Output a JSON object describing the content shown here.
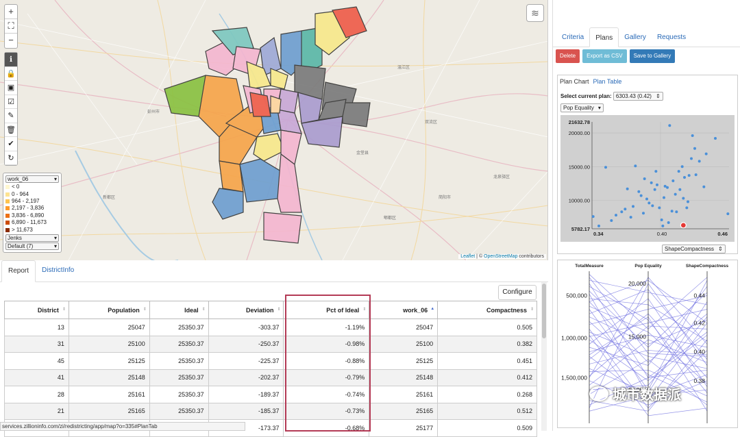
{
  "map": {
    "zoom_in": "+",
    "fullscreen": "⛶",
    "zoom_out": "−",
    "legend": {
      "field": "work_06",
      "items": [
        {
          "label": "< 0",
          "color": "#fff7cf"
        },
        {
          "label": "0 - 964",
          "color": "#fee391"
        },
        {
          "label": "964 - 2,197",
          "color": "#fec44f"
        },
        {
          "label": "2,197 - 3,836",
          "color": "#fe9929"
        },
        {
          "label": "3,836 - 6,890",
          "color": "#ec7014"
        },
        {
          "label": "6,890 - 11,673",
          "color": "#cc4c02"
        },
        {
          "label": "> 11,673",
          "color": "#8c2d04"
        }
      ],
      "method": "Jenks",
      "classes": "Default (7)"
    },
    "attribution_leaflet": "Leaflet",
    "attribution_sep": " | © ",
    "attribution_osm": "OpenStreetMap",
    "attribution_tail": " contributors",
    "place_labels": [
      {
        "t": "彭州市"
      },
      {
        "t": "温江区"
      },
      {
        "t": "双流区"
      },
      {
        "t": "新都区"
      },
      {
        "t": "龙泉驿区"
      },
      {
        "t": "郫都区"
      },
      {
        "t": "简阳市"
      },
      {
        "t": "金堂县"
      }
    ]
  },
  "report": {
    "tabs": [
      "Report",
      "DistrictInfo"
    ],
    "configure": "Configure",
    "columns": [
      "District",
      "Population",
      "Ideal",
      "Deviation",
      "Pct of Ideal",
      "work_06",
      "Compactness"
    ],
    "rows": [
      [
        "13",
        "25047",
        "25350.37",
        "-303.37",
        "-1.19%",
        "25047",
        "0.505"
      ],
      [
        "31",
        "25100",
        "25350.37",
        "-250.37",
        "-0.98%",
        "25100",
        "0.382"
      ],
      [
        "45",
        "25125",
        "25350.37",
        "-225.37",
        "-0.88%",
        "25125",
        "0.451"
      ],
      [
        "41",
        "25148",
        "25350.37",
        "-202.37",
        "-0.79%",
        "25148",
        "0.412"
      ],
      [
        "28",
        "25161",
        "25350.37",
        "-189.37",
        "-0.74%",
        "25161",
        "0.268"
      ],
      [
        "21",
        "25165",
        "25350.37",
        "-185.37",
        "-0.73%",
        "25165",
        "0.512"
      ],
      [
        "17",
        "25177",
        "25350.37",
        "-173.37",
        "-0.68%",
        "25177",
        "0.509"
      ]
    ],
    "url": "services.zillioninfo.com/zi/redistricting/app/map?o=335#PlanTab"
  },
  "right": {
    "tabs": [
      "Criteria",
      "Plans",
      "Gallery",
      "Requests"
    ],
    "buttons": {
      "delete": "Delete",
      "export": "Export as CSV",
      "save": "Save to Gallery"
    },
    "chart_tabs": [
      "Plan Chart",
      "Plan Table"
    ],
    "select_label": "Select current plan:",
    "select_value": "6303.43 (0.42)",
    "y_metric": "Pop Equality",
    "x_metric": "ShapeCompactness"
  },
  "chart_data": [
    {
      "type": "scatter",
      "title": "",
      "xlabel": "ShapeCompactness",
      "ylabel": "Pop Equality",
      "xlim": [
        0.34,
        0.46
      ],
      "ylim": [
        5782.17,
        21632.78
      ],
      "x_ticks": [
        "0.34",
        "0.40",
        "0.46"
      ],
      "y_ticks": [
        "21632.78",
        "20000.00",
        "15000.00",
        "10000.00",
        "5782.17"
      ],
      "points": [
        [
          0.341,
          7600
        ],
        [
          0.346,
          6200
        ],
        [
          0.352,
          14900
        ],
        [
          0.357,
          7000
        ],
        [
          0.361,
          7800
        ],
        [
          0.366,
          8300
        ],
        [
          0.369,
          8700
        ],
        [
          0.371,
          11700
        ],
        [
          0.374,
          7500
        ],
        [
          0.376,
          9100
        ],
        [
          0.378,
          15100
        ],
        [
          0.381,
          11300
        ],
        [
          0.383,
          10700
        ],
        [
          0.385,
          8100
        ],
        [
          0.386,
          13200
        ],
        [
          0.388,
          10200
        ],
        [
          0.39,
          9600
        ],
        [
          0.392,
          12600
        ],
        [
          0.393,
          9200
        ],
        [
          0.395,
          11600
        ],
        [
          0.396,
          14300
        ],
        [
          0.397,
          12300
        ],
        [
          0.399,
          8900
        ],
        [
          0.401,
          7100
        ],
        [
          0.402,
          6200
        ],
        [
          0.403,
          10400
        ],
        [
          0.404,
          12100
        ],
        [
          0.406,
          11900
        ],
        [
          0.407,
          6700
        ],
        [
          0.408,
          21100
        ],
        [
          0.41,
          8400
        ],
        [
          0.411,
          12900
        ],
        [
          0.413,
          10900
        ],
        [
          0.414,
          8300
        ],
        [
          0.416,
          14300
        ],
        [
          0.417,
          11600
        ],
        [
          0.419,
          15000
        ],
        [
          0.42,
          10300
        ],
        [
          0.421,
          13400
        ],
        [
          0.423,
          8900
        ],
        [
          0.424,
          9800
        ],
        [
          0.425,
          13700
        ],
        [
          0.427,
          16200
        ],
        [
          0.428,
          19600
        ],
        [
          0.43,
          17700
        ],
        [
          0.431,
          13800
        ],
        [
          0.434,
          15800
        ],
        [
          0.438,
          12000
        ],
        [
          0.44,
          16900
        ],
        [
          0.448,
          19200
        ],
        [
          0.459,
          8000
        ]
      ],
      "selected": [
        0.42,
        6303.43
      ],
      "grid": true
    },
    {
      "type": "line",
      "title": "",
      "axes": [
        "TotalMeasure",
        "Pop Equality",
        "ShapeCompactness"
      ],
      "axis0_ticks": [
        "1,500,000",
        "1,000,000",
        "500,000"
      ],
      "axis1_ticks": [
        "20,000",
        "15,000",
        "10,000"
      ],
      "axis2_ticks": [
        "0.44",
        "0.42",
        "0.40",
        "0.38"
      ],
      "lines": [
        [
          0.08,
          0.18,
          0.22
        ],
        [
          0.12,
          0.3,
          0.35
        ],
        [
          0.15,
          0.08,
          0.55
        ],
        [
          0.19,
          0.42,
          0.12
        ],
        [
          0.22,
          0.25,
          0.7
        ],
        [
          0.25,
          0.55,
          0.4
        ],
        [
          0.28,
          0.12,
          0.28
        ],
        [
          0.31,
          0.64,
          0.62
        ],
        [
          0.34,
          0.35,
          0.18
        ],
        [
          0.36,
          0.2,
          0.8
        ],
        [
          0.39,
          0.48,
          0.45
        ],
        [
          0.42,
          0.72,
          0.3
        ],
        [
          0.44,
          0.15,
          0.66
        ],
        [
          0.47,
          0.58,
          0.5
        ],
        [
          0.5,
          0.38,
          0.9
        ],
        [
          0.52,
          0.82,
          0.24
        ],
        [
          0.55,
          0.28,
          0.58
        ],
        [
          0.57,
          0.66,
          0.75
        ],
        [
          0.6,
          0.44,
          0.36
        ],
        [
          0.62,
          0.1,
          0.48
        ],
        [
          0.65,
          0.75,
          0.84
        ],
        [
          0.67,
          0.32,
          0.14
        ],
        [
          0.7,
          0.52,
          0.68
        ],
        [
          0.72,
          0.88,
          0.42
        ],
        [
          0.75,
          0.22,
          0.94
        ],
        [
          0.77,
          0.6,
          0.26
        ],
        [
          0.8,
          0.4,
          0.72
        ],
        [
          0.82,
          0.78,
          0.54
        ],
        [
          0.85,
          0.18,
          0.32
        ],
        [
          0.87,
          0.5,
          0.86
        ],
        [
          0.9,
          0.68,
          0.2
        ],
        [
          0.92,
          0.3,
          0.6
        ],
        [
          0.94,
          0.86,
          0.78
        ],
        [
          0.96,
          0.46,
          0.44
        ],
        [
          0.98,
          0.62,
          0.96
        ],
        [
          0.1,
          0.92,
          0.38
        ],
        [
          0.3,
          0.96,
          0.52
        ],
        [
          0.58,
          0.05,
          0.1
        ],
        [
          0.8,
          0.94,
          0.66
        ],
        [
          0.45,
          0.7,
          0.08
        ]
      ]
    }
  ],
  "watermark": "城市数据派"
}
